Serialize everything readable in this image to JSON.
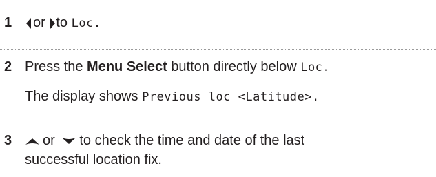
{
  "steps": [
    {
      "number": "1",
      "line1": {
        "left_icon": "left-arrow-icon",
        "or": "or",
        "right_icon": "right-arrow-icon",
        "to": "to",
        "code": "Loc."
      }
    },
    {
      "number": "2",
      "line1": {
        "pre": "Press the",
        "bold": "Menu Select",
        "post": "button directly below",
        "code": "Loc."
      },
      "line2": {
        "pre": "The display shows",
        "code": "Previous loc <Latitude>."
      }
    },
    {
      "number": "3",
      "line1": {
        "up_icon": "up-arrow-icon",
        "or": "or",
        "down_icon": "down-arrow-icon",
        "text": "to check the time and date of the last"
      },
      "line2": {
        "text": "successful location fix."
      }
    }
  ],
  "colors": {
    "text": "#231f20",
    "divider": "#9a9a9a"
  }
}
